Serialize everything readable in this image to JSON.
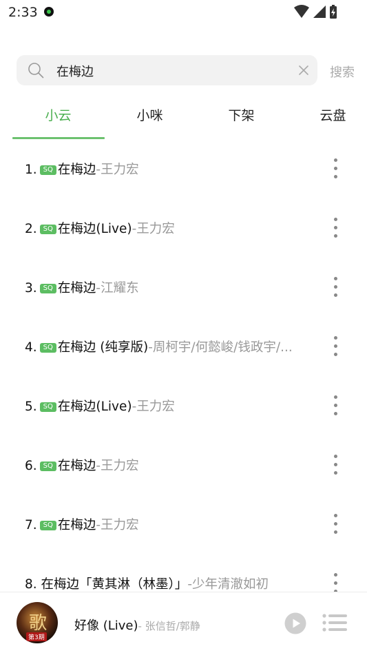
{
  "status_bar": {
    "time": "2:33"
  },
  "search": {
    "query": "在梅边",
    "button_label": "搜索"
  },
  "tabs": [
    {
      "label": "小云",
      "active": true
    },
    {
      "label": "小咪",
      "active": false
    },
    {
      "label": "下架",
      "active": false
    },
    {
      "label": "云盘",
      "active": false
    }
  ],
  "results": [
    {
      "index": "1.",
      "badge": "SQ",
      "title": "在梅边",
      "artist": "-王力宏"
    },
    {
      "index": "2.",
      "badge": "SQ",
      "title": "在梅边(Live)",
      "artist": "-王力宏"
    },
    {
      "index": "3.",
      "badge": "SQ",
      "title": "在梅边",
      "artist": "-江耀东"
    },
    {
      "index": "4.",
      "badge": "SQ",
      "title": "在梅边 (纯享版)",
      "artist": "-周柯宇/何懿峻/钱政宇/..."
    },
    {
      "index": "5.",
      "badge": "SQ",
      "title": "在梅边(Live)",
      "artist": "-王力宏"
    },
    {
      "index": "6.",
      "badge": "SQ",
      "title": "在梅边",
      "artist": "-王力宏"
    },
    {
      "index": "7.",
      "badge": "SQ",
      "title": "在梅边",
      "artist": "-王力宏"
    },
    {
      "index": "8.",
      "badge": "",
      "title": "在梅边「黄其淋（林墨）」",
      "artist": "-少年清澈如初"
    }
  ],
  "now_playing": {
    "title": "好像 (Live)",
    "artist": "- 张信哲/郭静"
  },
  "colors": {
    "accent": "#4caf50",
    "badge": "#5cbd62"
  }
}
